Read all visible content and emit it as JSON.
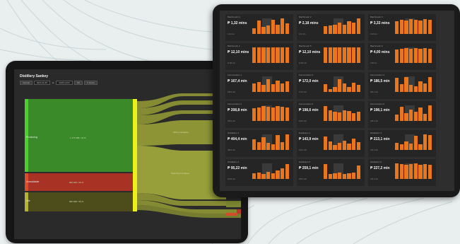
{
  "sankey_screen": {
    "title": "Distillery Sankey",
    "toolbar": {
      "shift_label": "Interval",
      "from_value": "2023-11-30",
      "to_sep": "to",
      "to_value": "2023-12-01",
      "go_label": "OK",
      "mode_label": "F Hours"
    },
    "nodes": [
      {
        "label": "Producing",
        "value": "1 176 488 / 34 %"
      },
      {
        "label": "Unavailable",
        "value": "983 188 / 29 %"
      },
      {
        "label": "Idle",
        "value": "982 188 / 29 %"
      }
    ],
    "flow_labels": [
      "Filling Complete",
      "Cleaning Complete"
    ],
    "colors": {
      "green": "#3a8a2a",
      "red": "#a83224",
      "olive": "#4d4d1c",
      "yellow": "#eef01a",
      "flow": "#8d9434"
    }
  },
  "kpi_screen": {
    "cards": [
      {
        "label": "Batchmash A",
        "value": "₱ 1,32 mins",
        "sub": "1.12 min",
        "bars": [
          0.35,
          0.85,
          0.45,
          0.55,
          0.9,
          0.6,
          1.0,
          0.7
        ]
      },
      {
        "label": "Batchmash 2",
        "value": "₱ 2,18 mins",
        "sub": "2.11 min",
        "bars": [
          0.5,
          0.55,
          0.6,
          0.75,
          0.6,
          0.8,
          0.75,
          1.0
        ]
      },
      {
        "label": "Batchmash 3",
        "value": "₱ 3,33 mins",
        "sub": "3.18 min",
        "bars": [
          0.8,
          0.9,
          0.85,
          0.95,
          0.9,
          0.85,
          0.95,
          0.9
        ]
      },
      {
        "label": "Batchmash 4",
        "value": "₱ 12,10 mins",
        "sub": "11.90 min",
        "bars": [
          1.0,
          1.0,
          1.0,
          1.0,
          1.0,
          1.0,
          1.0,
          1.0
        ]
      },
      {
        "label": "Batchmash 5",
        "value": "₱ 12,10 mins",
        "sub": "11.90 min",
        "bars": [
          1.0,
          1.0,
          1.0,
          1.0,
          1.0,
          1.0,
          1.0,
          1.0
        ]
      },
      {
        "label": "Batchmash 6",
        "value": "₱ 4,00 mins",
        "sub": "3.90 min",
        "bars": [
          0.85,
          0.9,
          0.95,
          0.9,
          0.95,
          0.9,
          0.95,
          0.9
        ]
      },
      {
        "label": "Fermentation 1",
        "value": "₱ 167,4 min",
        "sub": "165.2 min",
        "bars": [
          0.55,
          0.65,
          0.45,
          0.8,
          0.5,
          0.75,
          0.55,
          0.7
        ]
      },
      {
        "label": "Fermentation 2",
        "value": "₱ 172,0 min",
        "sub": "170.0 min",
        "bars": [
          0.5,
          0.2,
          0.3,
          0.8,
          0.55,
          0.3,
          0.6,
          0.45
        ]
      },
      {
        "label": "Fermentation 3",
        "value": "₱ 186,5 min",
        "sub": "184.1 min",
        "bars": [
          0.9,
          0.5,
          0.95,
          0.45,
          0.35,
          0.7,
          0.55,
          0.95
        ]
      },
      {
        "label": "Fermentation 4",
        "value": "₱ 208,8 min",
        "sub": "205.0 min",
        "bars": [
          0.8,
          0.85,
          0.95,
          0.9,
          0.85,
          0.95,
          0.9,
          0.85
        ]
      },
      {
        "label": "Fermentation 5",
        "value": "₱ 198,6 min",
        "sub": "195.2 min",
        "bars": [
          0.95,
          0.7,
          0.6,
          0.55,
          0.7,
          0.65,
          0.5,
          0.6
        ]
      },
      {
        "label": "Fermentation 6",
        "value": "₱ 198,1 min",
        "sub": "195.4 min",
        "bars": [
          0.4,
          0.9,
          0.5,
          0.75,
          0.6,
          0.85,
          0.45,
          1.0
        ]
      },
      {
        "label": "Distillation 1",
        "value": "₱ 404,4 min",
        "sub": "398.0 min",
        "bars": [
          0.7,
          0.5,
          0.8,
          0.45,
          0.35,
          0.95,
          0.5,
          1.0
        ]
      },
      {
        "label": "Distillation 2",
        "value": "₱ 143,9 min",
        "sub": "140.1 min",
        "bars": [
          0.85,
          0.55,
          0.3,
          0.45,
          0.6,
          0.4,
          0.75,
          0.5
        ]
      },
      {
        "label": "Distillation 3",
        "value": "₱ 213,1 min",
        "sub": "210.2 min",
        "bars": [
          0.45,
          0.35,
          0.55,
          0.4,
          0.9,
          0.35,
          1.0,
          0.95
        ]
      },
      {
        "label": "Distillation 4",
        "value": "₱ 95,22 min",
        "sub": "93.40 min",
        "bars": [
          0.35,
          0.4,
          0.3,
          0.45,
          0.35,
          0.55,
          0.7,
          0.95
        ]
      },
      {
        "label": "Distillation 5",
        "value": "₱ 259,1 min",
        "sub": "255.3 min",
        "bars": [
          0.95,
          0.3,
          0.35,
          0.4,
          0.3,
          0.35,
          0.4,
          0.85
        ]
      },
      {
        "label": "Distillation 6",
        "value": "₱ 227,2 min",
        "sub": "223.0 min",
        "bars": [
          1.0,
          0.95,
          0.9,
          0.95,
          1.0,
          0.9,
          0.95,
          0.9
        ]
      }
    ],
    "bar_color": "#e9761c"
  }
}
